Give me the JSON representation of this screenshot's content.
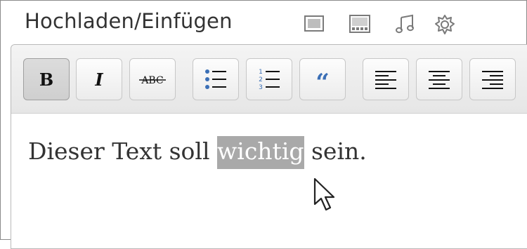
{
  "upload": {
    "label": "Hochladen/Einfügen",
    "icons": [
      "image-icon",
      "video-icon",
      "audio-icon",
      "media-icon"
    ]
  },
  "toolbar": {
    "buttons": [
      {
        "name": "bold-button",
        "icon": "bold-icon",
        "glyph": "B",
        "active": true
      },
      {
        "name": "italic-button",
        "icon": "italic-icon",
        "glyph": "I",
        "active": false
      },
      {
        "name": "strikethrough-button",
        "icon": "strikethrough-icon",
        "glyph": "ABC",
        "active": false
      },
      {
        "name": "bullet-list-button",
        "icon": "bullet-list-icon",
        "active": false
      },
      {
        "name": "numbered-list-button",
        "icon": "numbered-list-icon",
        "active": false
      },
      {
        "name": "blockquote-button",
        "icon": "quote-icon",
        "glyph": "“",
        "active": false
      },
      {
        "name": "align-left-button",
        "icon": "align-left-icon",
        "active": false
      },
      {
        "name": "align-center-button",
        "icon": "align-center-icon",
        "active": false
      },
      {
        "name": "align-right-button",
        "icon": "align-right-icon",
        "active": false
      }
    ]
  },
  "editor": {
    "text_before": "Dieser Text soll ",
    "selected_text": "wichtig",
    "text_after": " sein."
  },
  "colors": {
    "selection": "#a9a9a9",
    "accent_blue": "#3b6fb6",
    "text": "#333333"
  }
}
